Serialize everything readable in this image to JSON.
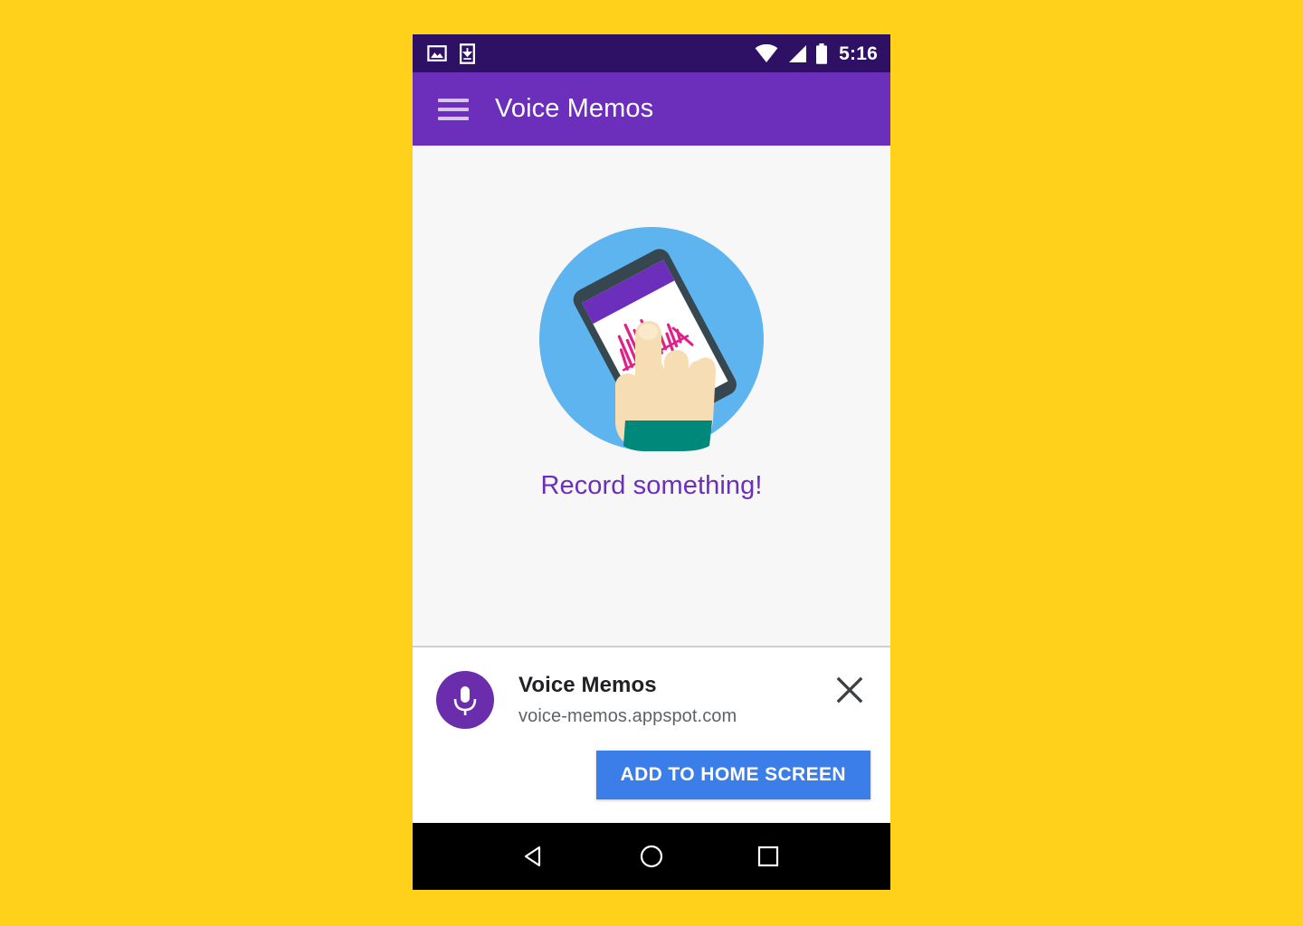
{
  "page": {
    "background_color": "#FFD11A"
  },
  "status_bar": {
    "background_color": "#2E1065",
    "time": "5:16",
    "left_icons": [
      {
        "name": "screenshot-image-icon",
        "label": "image"
      },
      {
        "name": "download-icon",
        "label": "download"
      }
    ],
    "right_icons": [
      {
        "name": "wifi-icon",
        "label": "wifi"
      },
      {
        "name": "cellular-signal-icon",
        "label": "signal"
      },
      {
        "name": "battery-icon",
        "label": "battery"
      }
    ]
  },
  "app_bar": {
    "background_color": "#6B2FBC",
    "title": "Voice Memos",
    "menu_icon": "hamburger-menu-icon"
  },
  "content": {
    "background_color": "#F7F7F7",
    "empty_state": {
      "message": "Record something!",
      "message_color": "#6B2FBC",
      "illustration": {
        "name": "hand-holding-phone-illustration",
        "circle_color": "#5DB4EF",
        "phone_body_color": "#37474F",
        "phone_screen_color": "#FFFFFF",
        "phone_header_color": "#6B2FBC",
        "waveform_color": "#E0218A",
        "skin_color": "#F7DDB4",
        "sleeve_color": "#00897B"
      }
    }
  },
  "install_banner": {
    "app_icon": {
      "name": "microphone-icon",
      "circle_color": "#6A2DAB"
    },
    "title": "Voice Memos",
    "url": "voice-memos.appspot.com",
    "close_icon": "close-icon",
    "install_button": {
      "label": "ADD TO HOME SCREEN",
      "color": "#3B7DE9"
    }
  },
  "nav_bar": {
    "background_color": "#000000",
    "buttons": [
      {
        "name": "back-button",
        "icon": "triangle-left-icon"
      },
      {
        "name": "home-button",
        "icon": "circle-icon"
      },
      {
        "name": "recents-button",
        "icon": "square-icon"
      }
    ]
  }
}
